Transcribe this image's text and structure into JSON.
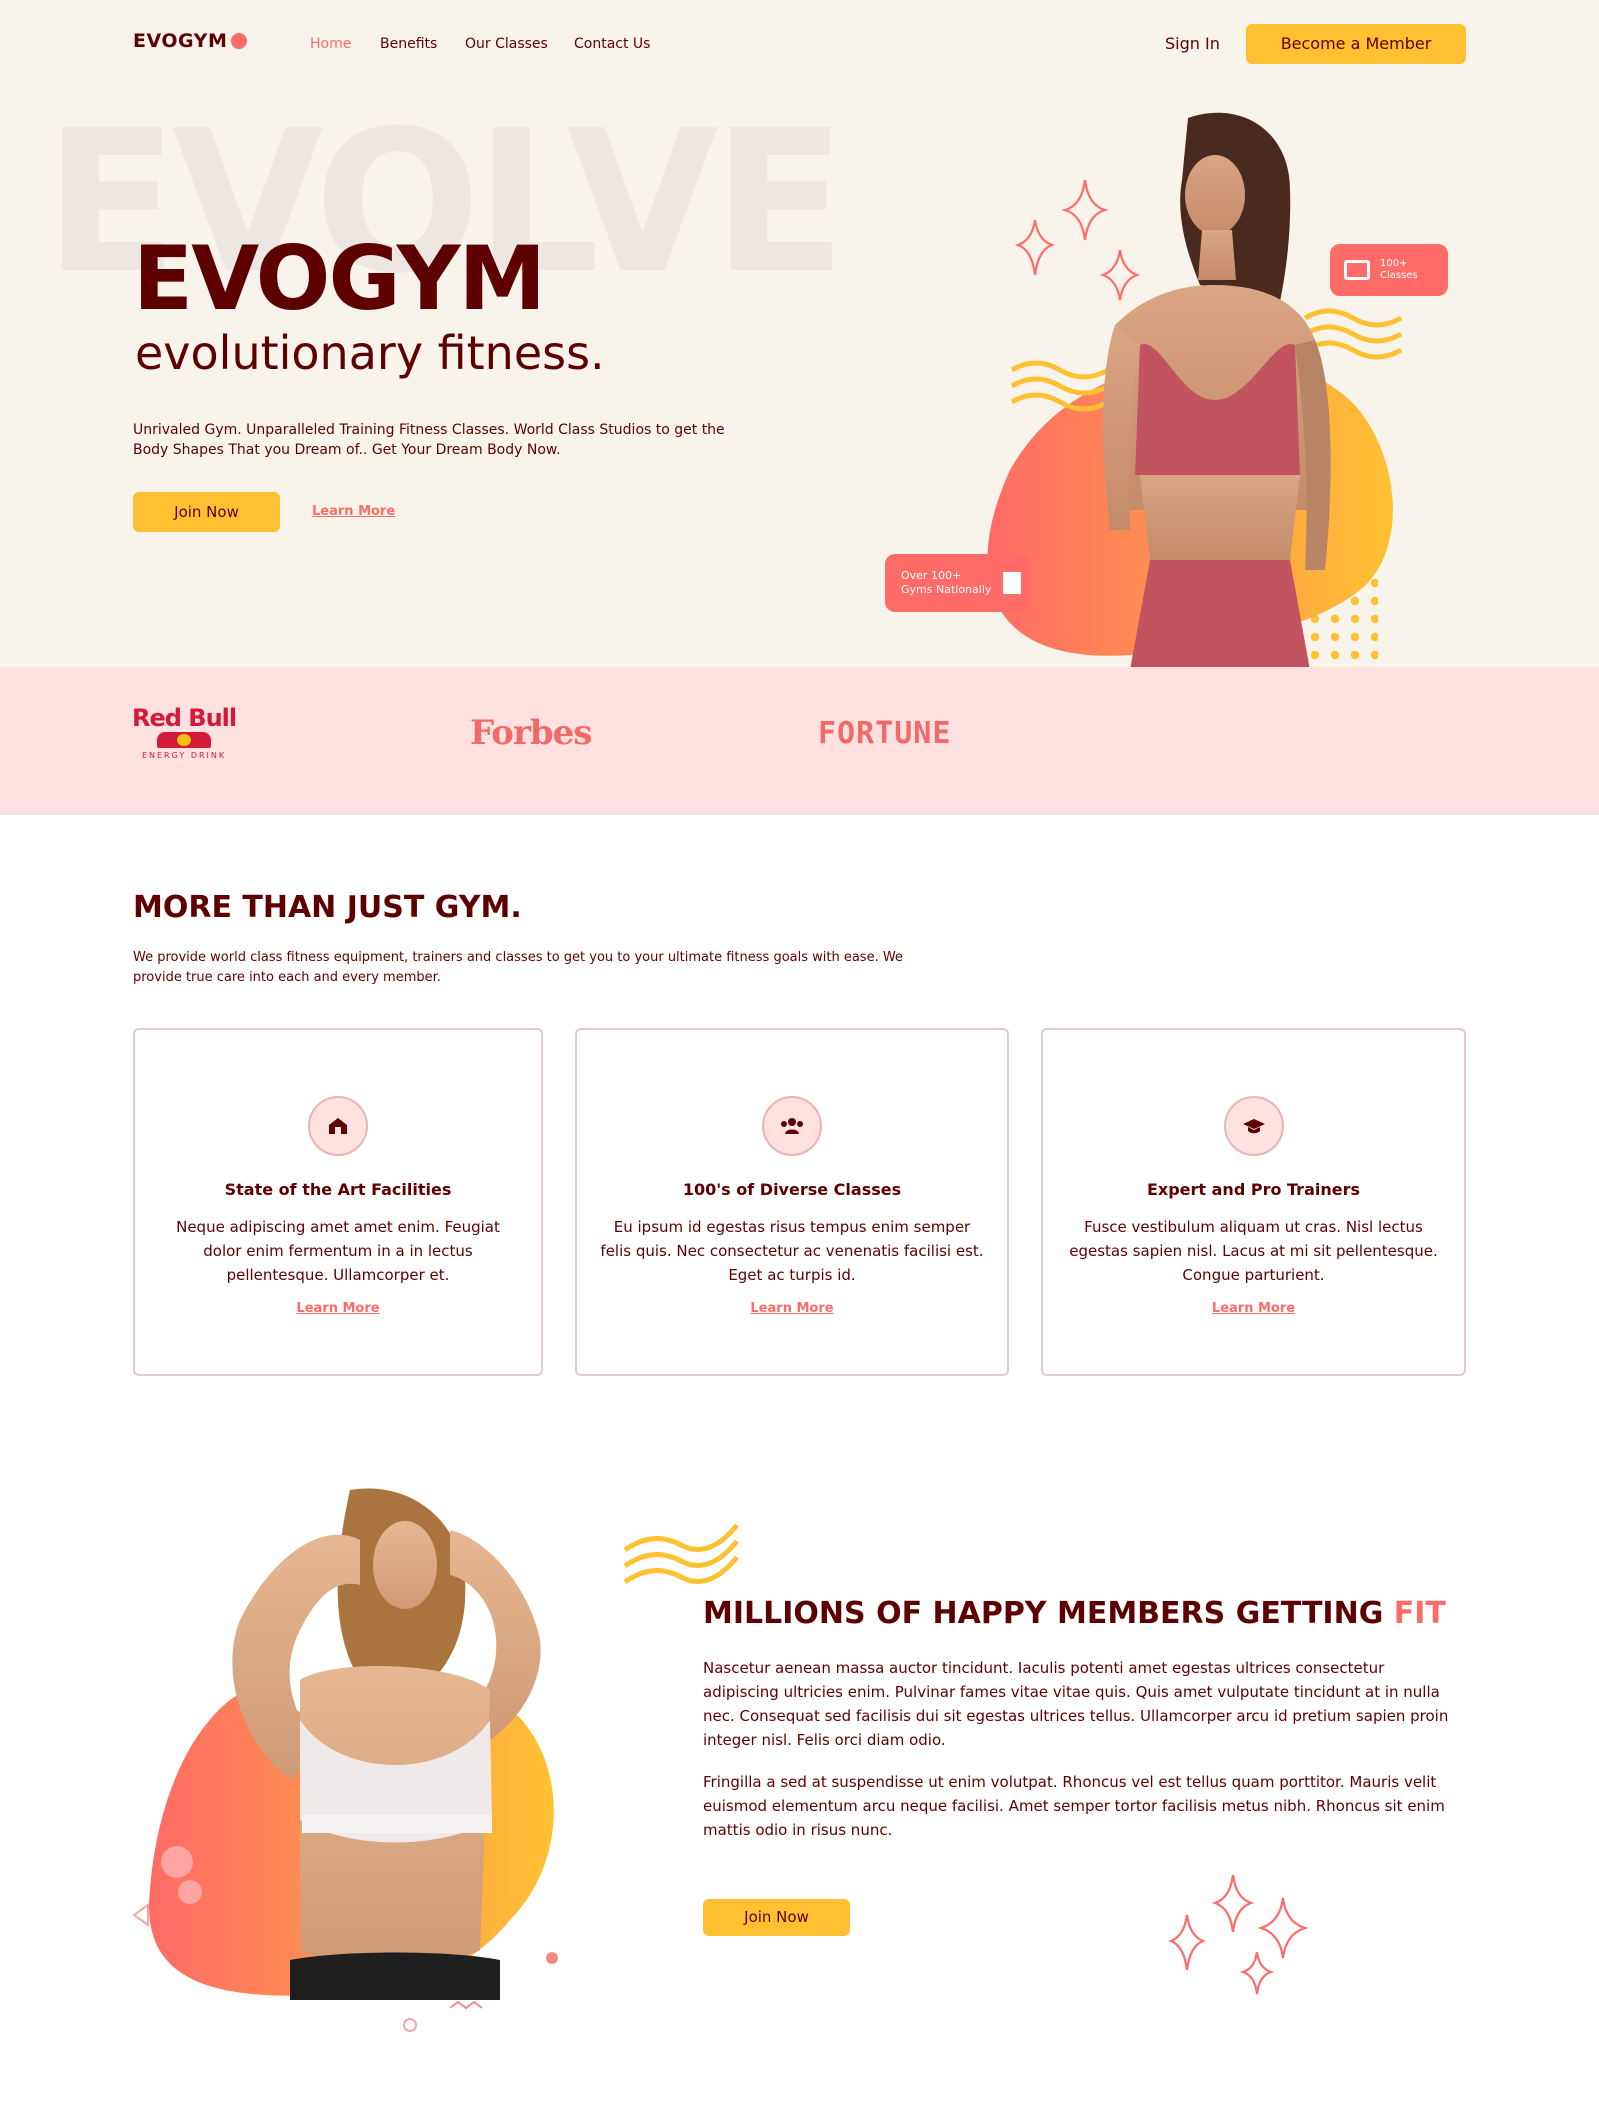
{
  "brand": {
    "name": "EVOGYM",
    "accent": "#FF6B66",
    "primary": "#5E0000",
    "yellow": "#FFC132"
  },
  "nav": {
    "links": [
      "Home",
      "Benefits",
      "Our Classes",
      "Contact Us"
    ],
    "sign_in": "Sign In",
    "cta": "Become a Member"
  },
  "hero": {
    "bg_word": "EVOLVE",
    "title": "EVOGYM",
    "subtitle": "evolutionary fitness.",
    "text": "Unrivaled Gym. Unparalleled Training Fitness Classes. World Class Studios to get the Body Shapes That you Dream of.. Get Your Dream Body Now.",
    "join": "Join Now",
    "learn": "Learn More",
    "badge_classes_1": "100+",
    "badge_classes_2": "Classes",
    "badge_gyms_1": "Over 100+",
    "badge_gyms_2": "Gyms Nationally"
  },
  "sponsors": {
    "redbull": "Red Bull",
    "redbull_sub": "ENERGY DRINK",
    "forbes": "Forbes",
    "fortune": "FORTUNE"
  },
  "benefits": {
    "heading": "MORE THAN JUST GYM.",
    "text": "We provide world class fitness equipment, trainers and classes to get you to your ultimate fitness goals with ease. We provide true care into each and every member.",
    "cards": [
      {
        "icon": "home-icon",
        "title": "State of the Art Facilities",
        "text": "Neque adipiscing amet amet enim. Feugiat dolor enim fermentum in a in lectus pellentesque. Ullamcorper et.",
        "link": "Learn More"
      },
      {
        "icon": "group-icon",
        "title": "100's of Diverse Classes",
        "text": "Eu ipsum id egestas risus tempus enim semper felis quis. Nec consectetur ac venenatis facilisi est. Eget ac turpis id.",
        "link": "Learn More"
      },
      {
        "icon": "graduation-cap-icon",
        "title": "Expert and Pro Trainers",
        "text": "Fusce vestibulum aliquam ut cras. Nisl lectus egestas sapien nisl. Lacus at mi sit pellentesque. Congue parturient.",
        "link": "Learn More"
      }
    ]
  },
  "members": {
    "heading_main": "MILLIONS OF HAPPY MEMBERS GETTING ",
    "heading_accent": "FIT",
    "p1": "Nascetur aenean massa auctor tincidunt. Iaculis potenti amet egestas ultrices consectetur adipiscing ultricies enim. Pulvinar fames vitae vitae quis. Quis amet vulputate tincidunt at in nulla nec. Consequat sed facilisis dui sit egestas ultrices tellus. Ullamcorper arcu id pretium sapien proin integer nisl. Felis orci diam odio.",
    "p2": "Fringilla a sed at suspendisse ut enim volutpat. Rhoncus vel est tellus quam porttitor. Mauris velit euismod elementum arcu neque facilisi. Amet semper tortor facilisis metus nibh. Rhoncus sit enim mattis odio in risus nunc.",
    "join": "Join Now"
  }
}
